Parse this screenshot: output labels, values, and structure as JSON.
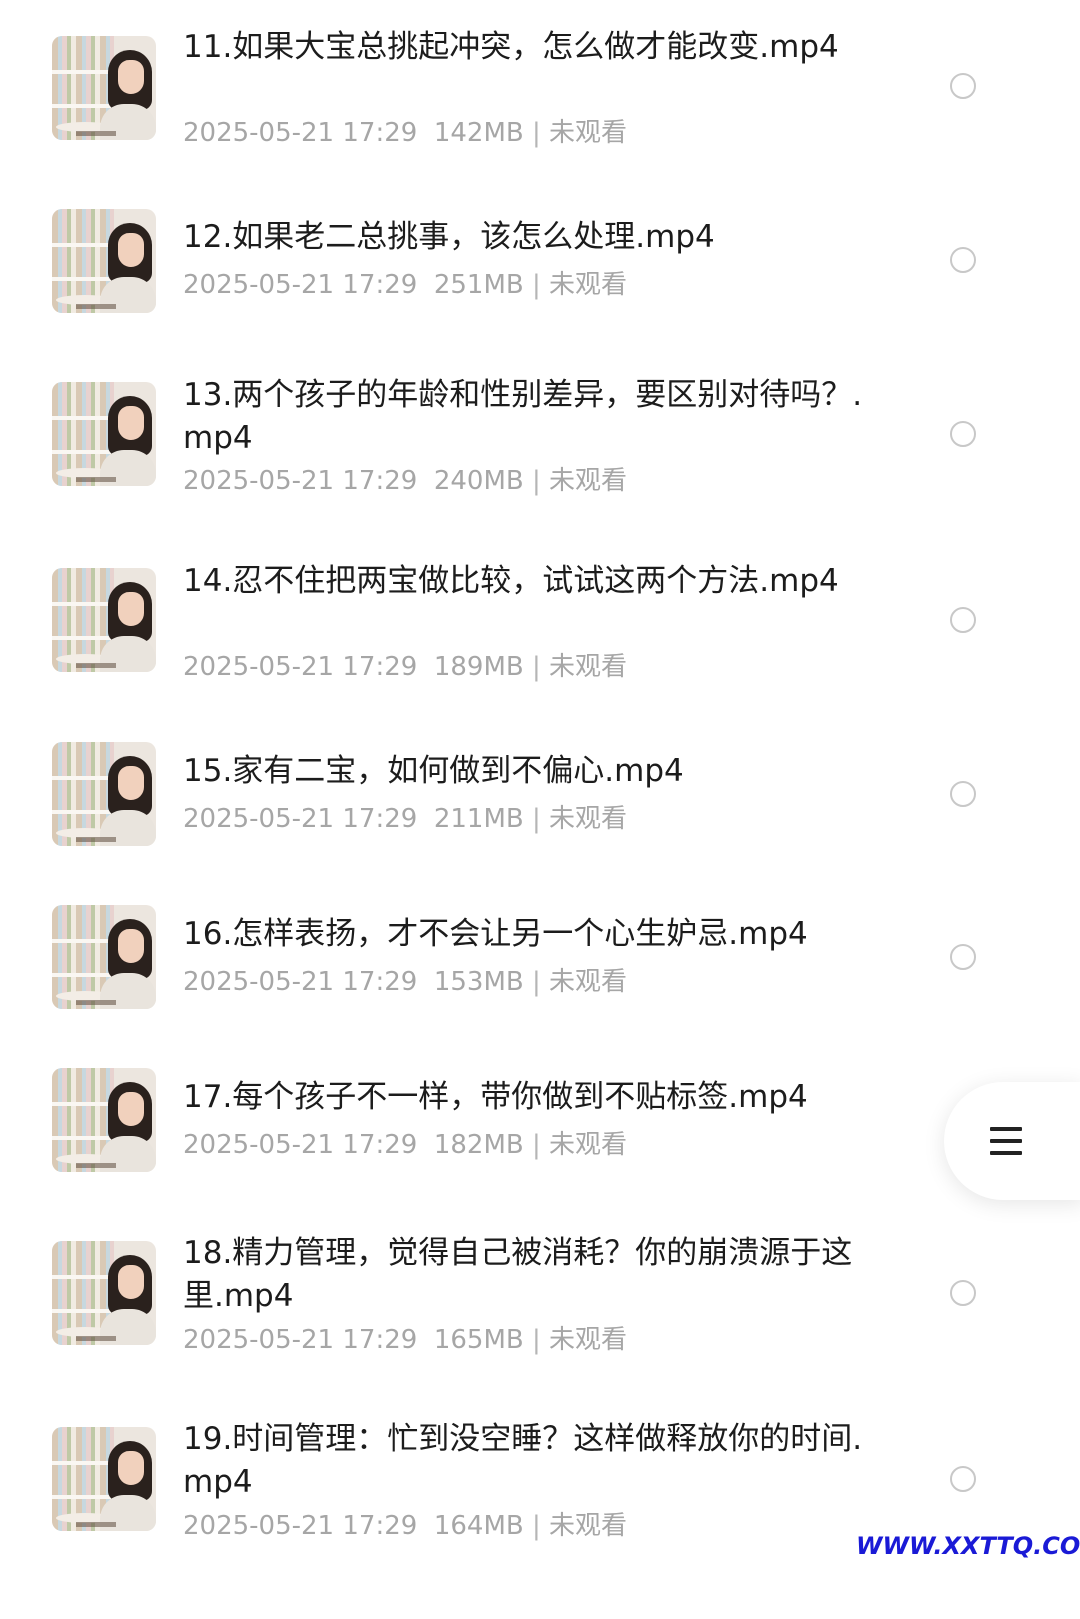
{
  "items": [
    {
      "title": "11.如果大宝总挑起冲突，怎么做才能改变.mp4",
      "date": "2025-05-21 17:29",
      "size": "142MB",
      "status": "未观看"
    },
    {
      "title": "12.如果老二总挑事，该怎么处理.mp4",
      "date": "2025-05-21 17:29",
      "size": "251MB",
      "status": "未观看"
    },
    {
      "title": "13.两个孩子的年龄和性别差异，要区别对待吗？.mp4",
      "date": "2025-05-21 17:29",
      "size": "240MB",
      "status": "未观看"
    },
    {
      "title": "14.忍不住把两宝做比较，试试这两个方法.mp4",
      "date": "2025-05-21 17:29",
      "size": "189MB",
      "status": "未观看"
    },
    {
      "title": "15.家有二宝，如何做到不偏心.mp4",
      "date": "2025-05-21 17:29",
      "size": "211MB",
      "status": "未观看"
    },
    {
      "title": "16.怎样表扬，才不会让另一个心生妒忌.mp4",
      "date": "2025-05-21 17:29",
      "size": "153MB",
      "status": "未观看"
    },
    {
      "title": "17.每个孩子不一样，带你做到不贴标签.mp4",
      "date": "2025-05-21 17:29",
      "size": "182MB",
      "status": "未观看"
    },
    {
      "title": "18.精力管理，觉得自己被消耗？你的崩溃源于这里.mp4",
      "date": "2025-05-21 17:29",
      "size": "165MB",
      "status": "未观看"
    },
    {
      "title": "19.时间管理：忙到没空睡？这样做释放你的时间.mp4",
      "date": "2025-05-21 17:29",
      "size": "164MB",
      "status": "未观看"
    }
  ],
  "meta_separator": "|",
  "menu_icon": "menu-lines-icon",
  "watermark": "WWW.XXTTQ.COM",
  "colors": {
    "title": "#1c1c1c",
    "meta": "#a6a6a6",
    "radio": "#c8c8c8",
    "watermark": "#1a1ad6"
  }
}
